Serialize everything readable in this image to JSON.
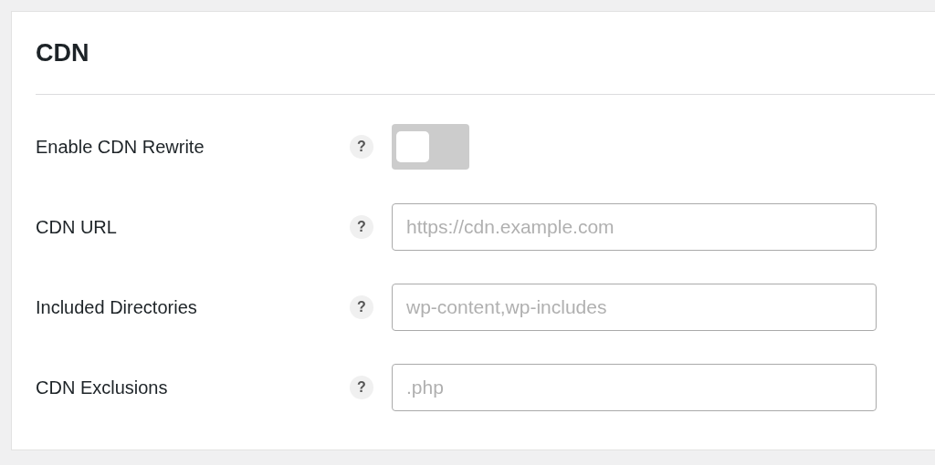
{
  "card": {
    "title": "CDN",
    "settings": [
      {
        "kind": "toggle",
        "label": "Enable CDN Rewrite",
        "help": "?",
        "on": false
      },
      {
        "kind": "text",
        "label": "CDN URL",
        "help": "?",
        "placeholder": "https://cdn.example.com"
      },
      {
        "kind": "text",
        "label": "Included Directories",
        "help": "?",
        "placeholder": "wp-content,wp-includes"
      },
      {
        "kind": "text",
        "label": "CDN Exclusions",
        "help": "?",
        "placeholder": ".php"
      }
    ]
  }
}
